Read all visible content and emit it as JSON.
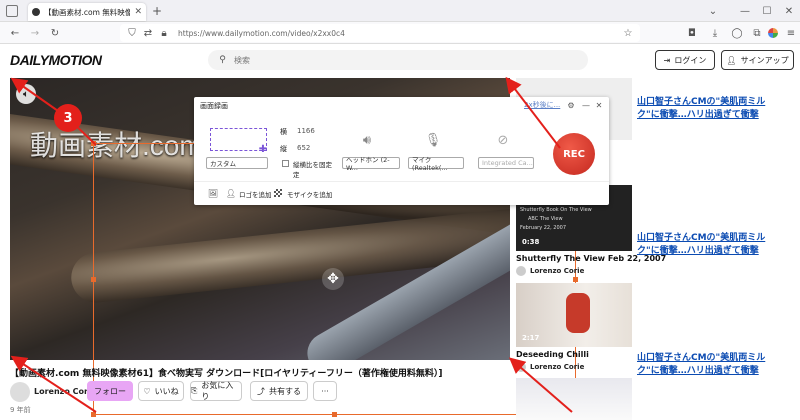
{
  "browser": {
    "tab_title": "【動画素材.com 無料映像素材61】",
    "url_full": "https://www.dailymotion.com/video/x2xx0c4"
  },
  "site": {
    "logo": "DAILYMOTION",
    "search_placeholder": "検索",
    "login_label": "ログイン",
    "signup_label": "サインアップ"
  },
  "video": {
    "overlay_text": "動画素材.com/movie61food.html",
    "title": "【動画素材.com 無料映像素材61】食べ物実写 ダウンロード[ロイヤリティーフリー（著作権使用料無料）]",
    "author": "Lorenzo Corie",
    "age": "9 年前",
    "follow_label": "フォロー",
    "like_label": "いいね",
    "favorite_label": "お気に入り",
    "share_label": "共有する",
    "more_label": "···"
  },
  "recorder": {
    "title": "画面録画",
    "width_label": "横",
    "width_value": "1166",
    "height_label": "縦",
    "height_value": "652",
    "preset": "カスタム",
    "aspect_lock_label": "縦横比を固定",
    "aspect_lock_label2": "定",
    "audio_device": "ヘッドホン (2- W...",
    "mic_device": "マイク (Realtek(...",
    "camera_device": "Integrated Ca...",
    "timer_link": "2x秒後に...",
    "btn_add_label": "ロゴを追加",
    "btn_mosaic_label": "モザイクを追加",
    "rec_label": "REC"
  },
  "annotation": {
    "step_number": "3"
  },
  "sidebar": {
    "ad_text_1": "山口智子さんCMの\"美肌両ミルク\"に衝撃…ハリ出過ぎて衝撃",
    "ad_text_2": "山口智子さんCMの\"美肌両ミルク\"に衝撃…ハリ出過ぎて衝撃",
    "ad_text_3": "山口智子さんCMの\"美肌両ミルク\"に衝撃…ハリ出過ぎて衝撃",
    "videos": [
      {
        "title": "Shutterfly The View Feb 22, 2007",
        "author": "Lorenzo Corie",
        "duration": "0:38",
        "thumb_text_1": "Shutterfly Book On The View",
        "thumb_text_2": "ABC The View",
        "thumb_text_3": "February 22, 2007"
      },
      {
        "title": "Deseeding Chilli",
        "author": "Lorenzo Corie",
        "duration": "2:17"
      }
    ]
  },
  "colors": {
    "rec_red": "#d9322a",
    "frame_orange": "#e86a2c",
    "badge_red": "#e3201b",
    "follow_pink": "#e8a6f5",
    "link_blue": "#0b4bb2"
  }
}
